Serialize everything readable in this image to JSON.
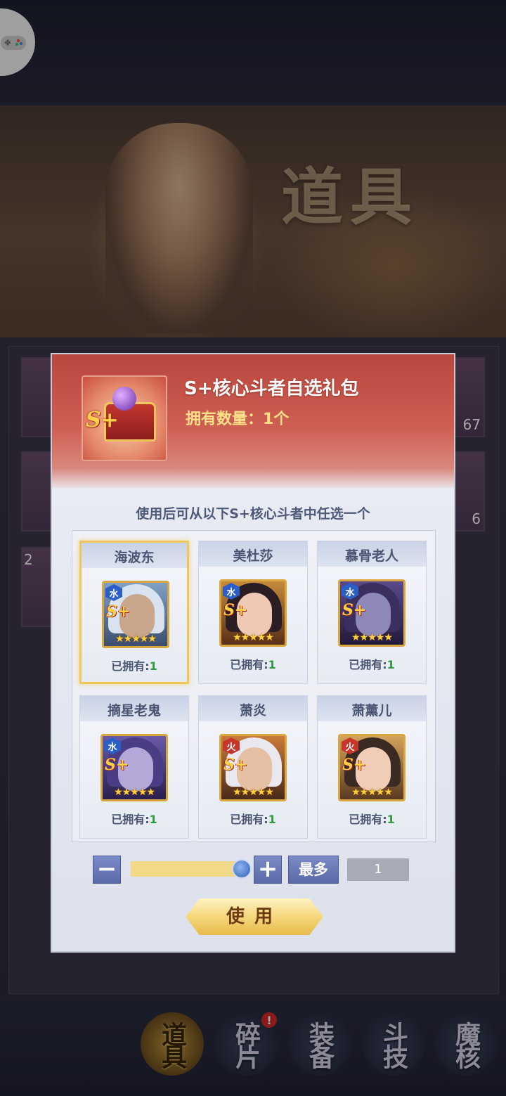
{
  "banner": {
    "title": "道具"
  },
  "background_items": [
    {
      "count": "67"
    },
    {
      "count": "6"
    },
    {
      "count": "2"
    }
  ],
  "nav": {
    "tabs": [
      {
        "label": "道具",
        "active": true
      },
      {
        "label": "碎片",
        "badge": "!"
      },
      {
        "label": "装备"
      },
      {
        "label": "斗技"
      },
      {
        "label": "魔核"
      }
    ]
  },
  "dialog": {
    "title": "S+核心斗者自选礼包",
    "owned": "拥有数量：1个",
    "item_badge": "S+",
    "description": "使用后可从以下S+核心斗者中任选一个",
    "heroes": [
      {
        "name": "海波东",
        "element": "水",
        "rank": "S+",
        "owned_label": "已拥有:",
        "owned_value": "1",
        "selected": true,
        "stars": 5
      },
      {
        "name": "美杜莎",
        "element": "水",
        "rank": "S+",
        "owned_label": "已拥有:",
        "owned_value": "1",
        "selected": false,
        "stars": 5
      },
      {
        "name": "慕骨老人",
        "element": "水",
        "rank": "S+",
        "owned_label": "已拥有:",
        "owned_value": "1",
        "selected": false,
        "stars": 5
      },
      {
        "name": "摘星老鬼",
        "element": "水",
        "rank": "S+",
        "owned_label": "已拥有:",
        "owned_value": "1",
        "selected": false,
        "stars": 5
      },
      {
        "name": "萧炎",
        "element": "火",
        "rank": "S+",
        "owned_label": "已拥有:",
        "owned_value": "1",
        "selected": false,
        "stars": 5
      },
      {
        "name": "萧薰儿",
        "element": "火",
        "rank": "S+",
        "owned_label": "已拥有:",
        "owned_value": "1",
        "selected": false,
        "stars": 5
      }
    ],
    "quantity": {
      "minus_label": "−",
      "plus_label": "+",
      "max_label": "最多",
      "value": "1",
      "slider_fraction": 1.0
    },
    "use_label": "使用"
  }
}
